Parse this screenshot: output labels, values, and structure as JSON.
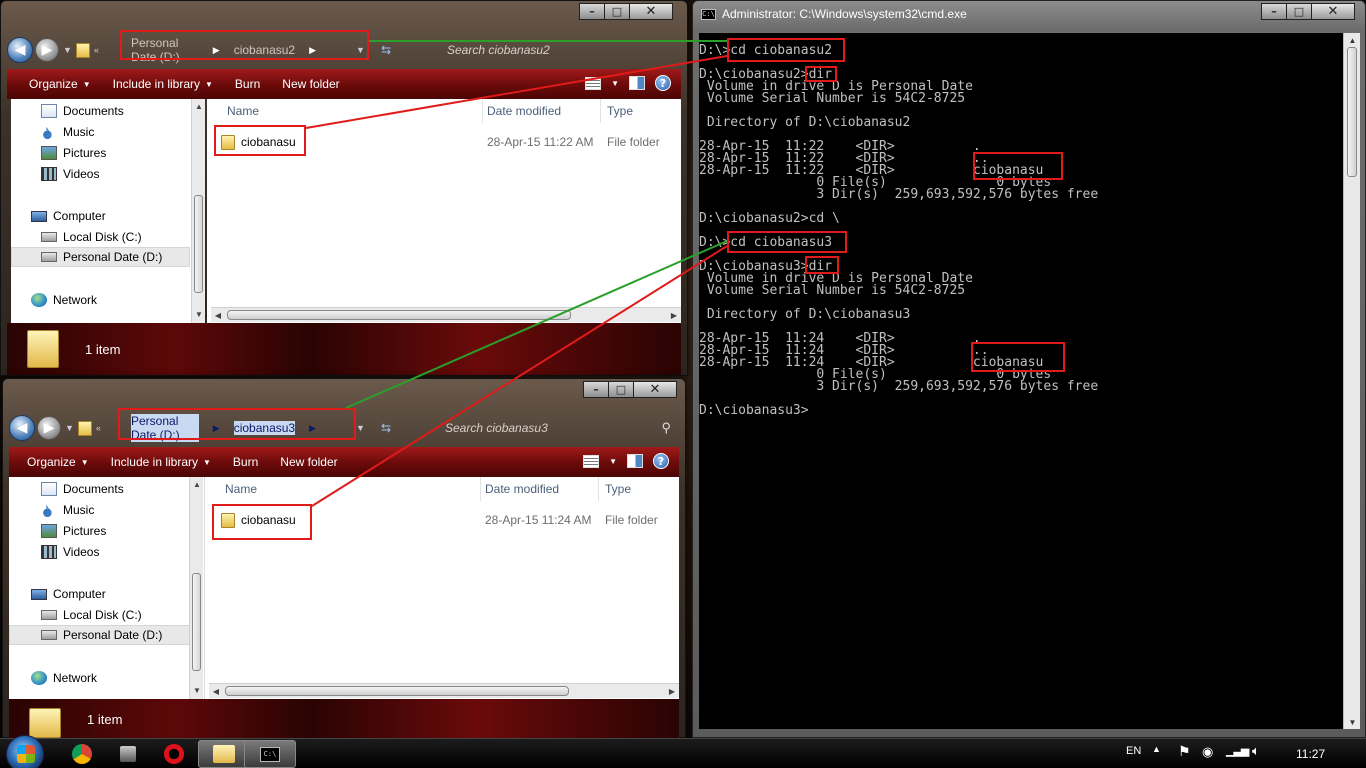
{
  "explorer_top": {
    "address": [
      "Personal Date (D:)",
      "ciobanasu2"
    ],
    "search_placeholder": "Search ciobanasu2",
    "toolbar": {
      "organize": "Organize",
      "include": "Include in library",
      "burn": "Burn",
      "new_folder": "New folder"
    },
    "nav": {
      "documents": "Documents",
      "music": "Music",
      "pictures": "Pictures",
      "videos": "Videos",
      "computer": "Computer",
      "local_disk": "Local Disk (C:)",
      "personal": "Personal Date (D:)",
      "network": "Network"
    },
    "columns": {
      "name": "Name",
      "date": "Date modified",
      "type": "Type"
    },
    "file": {
      "name": "ciobanasu",
      "date": "28-Apr-15 11:22 AM",
      "type": "File folder"
    },
    "status": "1 item"
  },
  "explorer_bottom": {
    "address": [
      "Personal Date (D:)",
      "ciobanasu3"
    ],
    "search_placeholder": "Search ciobanasu3",
    "toolbar": {
      "organize": "Organize",
      "include": "Include in library",
      "burn": "Burn",
      "new_folder": "New folder"
    },
    "nav": {
      "documents": "Documents",
      "music": "Music",
      "pictures": "Pictures",
      "videos": "Videos",
      "computer": "Computer",
      "local_disk": "Local Disk (C:)",
      "personal": "Personal Date (D:)",
      "network": "Network"
    },
    "columns": {
      "name": "Name",
      "date": "Date modified",
      "type": "Type"
    },
    "file": {
      "name": "ciobanasu",
      "date": "28-Apr-15 11:24 AM",
      "type": "File folder"
    },
    "status": "1 item"
  },
  "cmd": {
    "title": "Administrator: C:\\Windows\\system32\\cmd.exe",
    "lines": [
      "D:\\>cd ciobanasu2",
      "",
      "D:\\ciobanasu2>dir",
      " Volume in drive D is Personal Date",
      " Volume Serial Number is 54C2-8725",
      "",
      " Directory of D:\\ciobanasu2",
      "",
      "28-Apr-15  11:22    <DIR>          .",
      "28-Apr-15  11:22    <DIR>          ..",
      "28-Apr-15  11:22    <DIR>          ciobanasu",
      "               0 File(s)              0 bytes",
      "               3 Dir(s)  259,693,592,576 bytes free",
      "",
      "D:\\ciobanasu2>cd \\",
      "",
      "D:\\>cd ciobanasu3",
      "",
      "D:\\ciobanasu3>dir",
      " Volume in drive D is Personal Date",
      " Volume Serial Number is 54C2-8725",
      "",
      " Directory of D:\\ciobanasu3",
      "",
      "28-Apr-15  11:24    <DIR>          .",
      "28-Apr-15  11:24    <DIR>          ..",
      "28-Apr-15  11:24    <DIR>          ciobanasu",
      "               0 File(s)              0 bytes",
      "               3 Dir(s)  259,693,592,576 bytes free",
      "",
      "D:\\ciobanasu3>"
    ]
  },
  "taskbar": {
    "lang": "EN",
    "time": "11:27"
  },
  "colors": {
    "highlight": "#e11a1a",
    "green_line": "#2aa02a",
    "toolbar_red": "#7a0c0c",
    "console_text": "#c0c0c0"
  },
  "icons": [
    "chrome-icon",
    "app-icon",
    "opera-icon",
    "explorer-icon",
    "cmd-icon"
  ]
}
